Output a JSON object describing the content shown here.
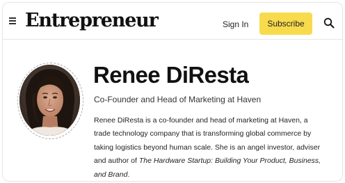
{
  "header": {
    "logo_text": "Entrepreneur",
    "menu_icon": "hamburger-menu-icon",
    "sign_in_label": "Sign In",
    "subscribe_label": "Subscribe",
    "search_icon": "search-icon",
    "subscribe_color": "#f7db4c"
  },
  "profile": {
    "photo": "author-portrait-photo",
    "name": "Renee DiResta",
    "role": "Co-Founder and Head of Marketing at Haven",
    "bio_lines": [
      "Renee DiResta is a co-founder and head of marketing at Haven, a",
      "trade technology company that is transforming global commerce by",
      "taking logistics beyond human scale. She is an angel investor, adviser"
    ],
    "bio_line4_prefix": "and author of ",
    "bio_book_title_part1": "The Hardware Startup: Building Your Product, Business,",
    "bio_book_title_part2": "and Brand",
    "bio_end": "."
  }
}
